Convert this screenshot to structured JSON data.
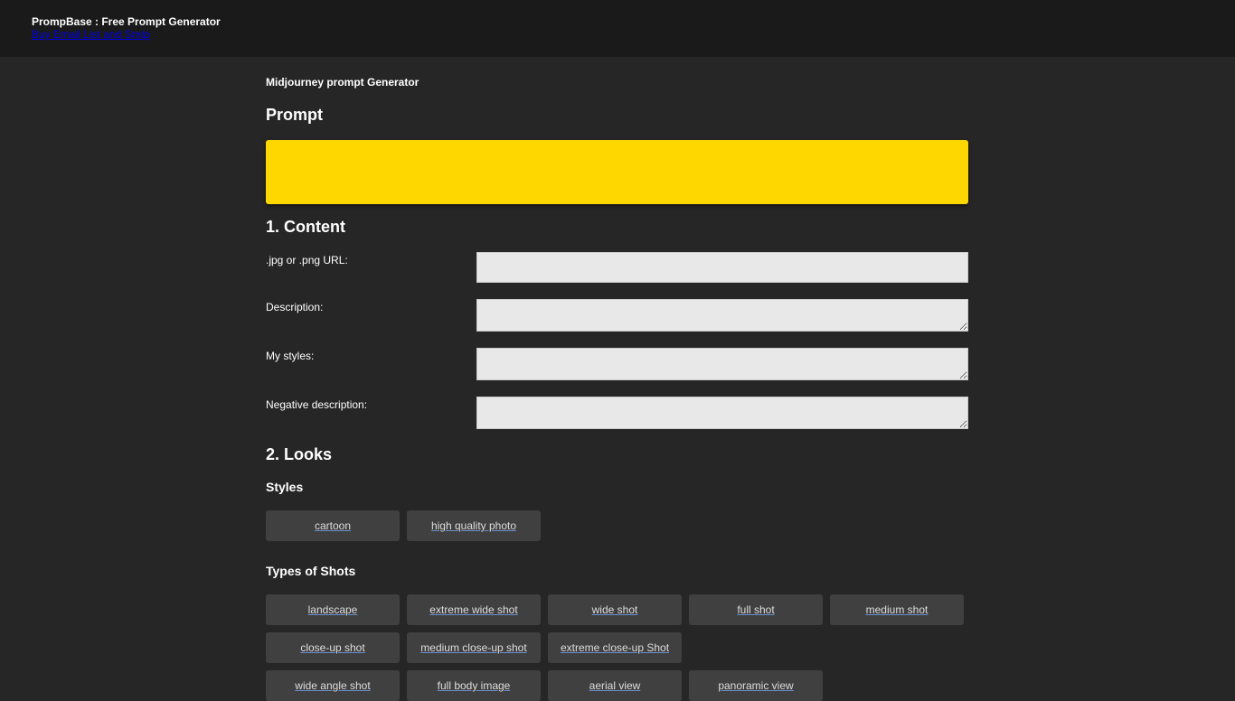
{
  "header": {
    "title": "PrompBase : Free Prompt Generator",
    "link": "Buy Email List and Smtp"
  },
  "main": {
    "subtitle": "Midjourney prompt Generator",
    "prompt_heading": "Prompt",
    "content_heading": "1. Content",
    "fields": [
      {
        "label": ".jpg or .png URL:"
      },
      {
        "label": "Description:"
      },
      {
        "label": "My styles:"
      },
      {
        "label": "Negative description:"
      }
    ],
    "looks_heading": "2. Looks",
    "styles_heading": "Styles",
    "styles": [
      "cartoon",
      "high quality photo"
    ],
    "shots_heading": "Types of Shots",
    "shots_rows": [
      [
        "landscape",
        "extreme wide shot",
        "wide shot",
        "full shot",
        "medium shot"
      ],
      [
        "close-up shot",
        "medium close-up shot",
        "extreme close-up Shot"
      ],
      [
        "wide angle shot",
        "full body image",
        "aerial view",
        "panoramic view"
      ]
    ]
  }
}
